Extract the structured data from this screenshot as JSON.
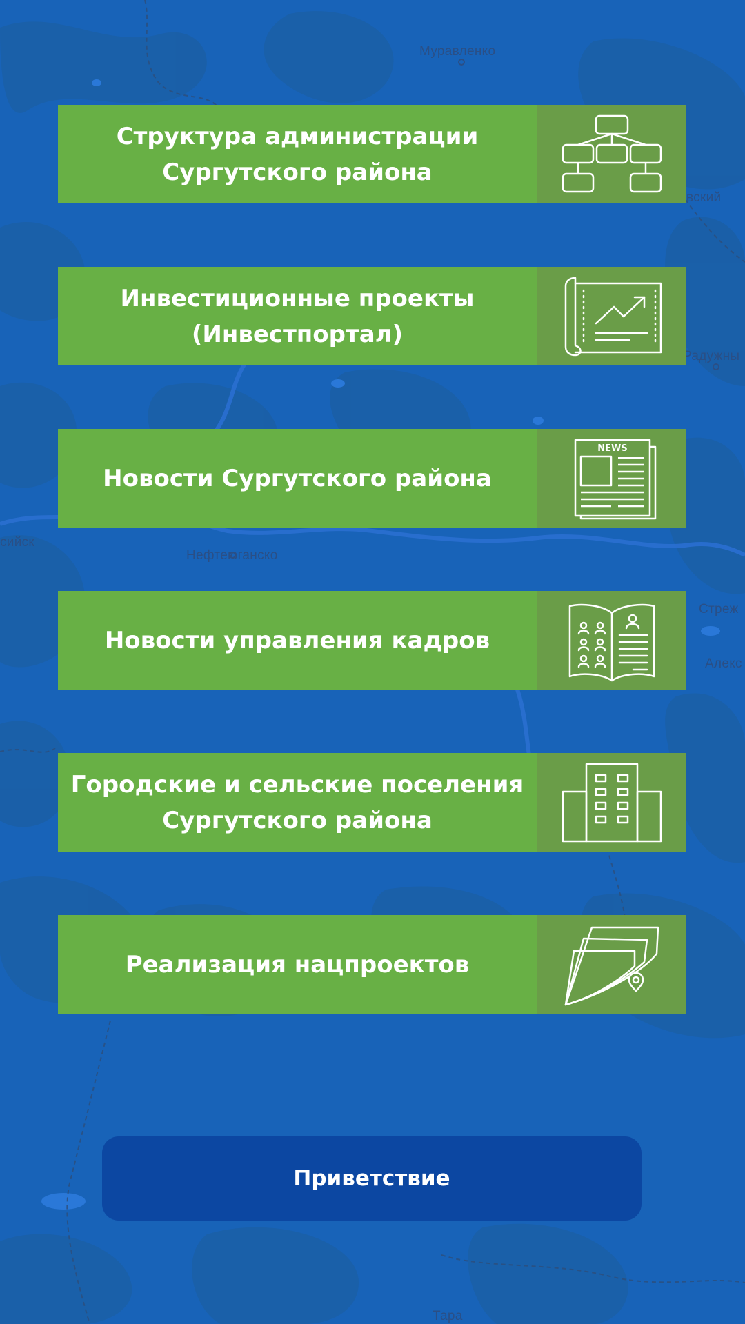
{
  "map": {
    "labels": [
      {
        "id": "muravlenko",
        "text": "Муравленко"
      },
      {
        "id": "vskiy",
        "text": "вский"
      },
      {
        "id": "raduzhny",
        "text": "Радужны"
      },
      {
        "id": "siysk",
        "text": "сийск"
      },
      {
        "id": "nefteyugansk",
        "text": "Нефтеюганско"
      },
      {
        "id": "strezh",
        "text": "Стреж"
      },
      {
        "id": "alek",
        "text": "Алекс"
      },
      {
        "id": "tara",
        "text": "Тара"
      }
    ]
  },
  "menu": [
    {
      "line1": "Структура администрации",
      "line2": "Сургутского района",
      "icon": "org-structure-icon"
    },
    {
      "line1": "Инвестиционные проекты",
      "line2": "(Инвестпортал)",
      "icon": "investment-chart-icon"
    },
    {
      "line1": "Новости Сургутского района",
      "line2": "",
      "icon": "newspaper-icon"
    },
    {
      "line1": "Новости управления кадров",
      "line2": "",
      "icon": "personnel-book-icon"
    },
    {
      "line1": "Городские и сельские поселения",
      "line2": "Сургутского района",
      "icon": "buildings-icon"
    },
    {
      "line1": "Реализация нацпроектов",
      "line2": "",
      "icon": "map-location-icon"
    }
  ],
  "news_icon_text": "NEWS",
  "greeting_button": "Приветствие",
  "colors": {
    "background": "#1863b8",
    "menu_green": "#68b045",
    "icon_panel_green": "#6a9d48",
    "button_blue": "#0c47a2"
  }
}
